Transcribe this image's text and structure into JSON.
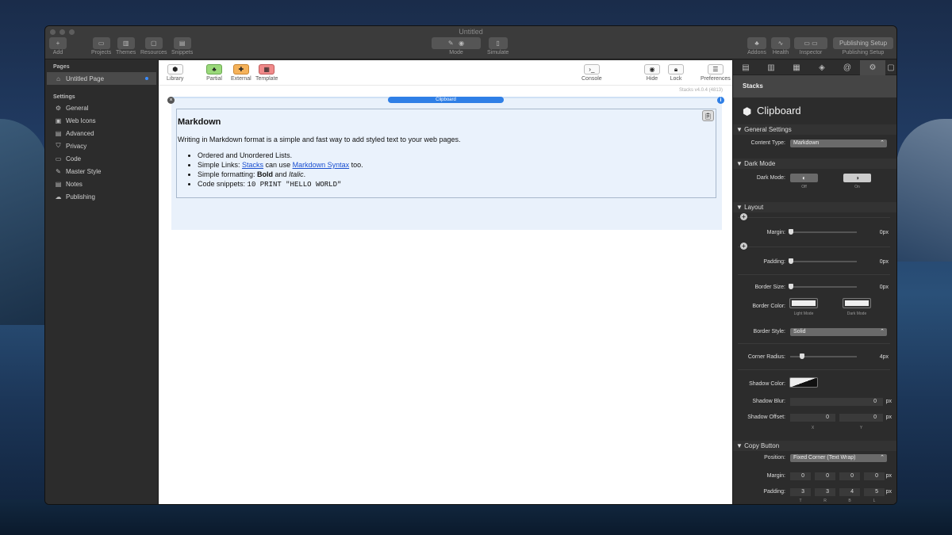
{
  "window": {
    "title": "Untitled"
  },
  "toolbar": {
    "add": "Add",
    "projects": "Projects",
    "themes": "Themes",
    "resources": "Resources",
    "snippets": "Snippets",
    "mode": "Mode",
    "simulate": "Simulate",
    "addons": "Addons",
    "health": "Health",
    "inspector": "Inspector",
    "publishing_setup_button": "Publishing Setup",
    "publishing_setup_label": "Publishing Setup"
  },
  "sidebar": {
    "pages_header": "Pages",
    "page": "Untitled Page",
    "settings_header": "Settings",
    "items": [
      "General",
      "Web Icons",
      "Advanced",
      "Privacy",
      "Code",
      "Master Style",
      "Notes",
      "Publishing"
    ]
  },
  "content_toolbar": {
    "library": "Library",
    "partial": "Partial",
    "external": "External",
    "template": "Template",
    "console": "Console",
    "hide": "Hide",
    "lock": "Lock",
    "preferences": "Preferences"
  },
  "stacks_version": "Stacks v4.0.4 (4813)",
  "stack": {
    "pill": "Clipboard",
    "heading": "Markdown",
    "intro": "Writing in Markdown format is a simple and fast way to add styled text to your web pages.",
    "li1": "Ordered and Unordered Lists.",
    "li2_pre": "Simple Links: ",
    "li2_link1": "Stacks",
    "li2_mid": " can use ",
    "li2_link2": "Markdown Syntax",
    "li2_post": " too.",
    "li3_pre": "Simple formatting: ",
    "li3_bold": "Bold",
    "li3_mid": " and ",
    "li3_italic": "Italic",
    "li3_post": ".",
    "li4_pre": "Code snippets: ",
    "li4_code": "10 PRINT \"HELLO WORLD\""
  },
  "inspector": {
    "header": "Stacks",
    "title": "Clipboard",
    "general_settings": "General Settings",
    "content_type_label": "Content Type:",
    "content_type": "Markdown",
    "dark_mode_section": "Dark Mode",
    "dark_mode_label": "Dark Mode:",
    "off": "Off",
    "on": "On",
    "layout_section": "Layout",
    "margin_label": "Margin:",
    "margin_val": "0px",
    "padding_label": "Padding:",
    "padding_val": "0px",
    "border_size_label": "Border Size:",
    "border_size_val": "0px",
    "border_color_label": "Border Color:",
    "light_mode": "Light Mode",
    "dark_mode": "Dark Mode",
    "border_style_label": "Border Style:",
    "border_style": "Solid",
    "corner_radius_label": "Corner Radius:",
    "corner_radius_val": "4px",
    "shadow_color_label": "Shadow Color:",
    "shadow_blur_label": "Shadow Blur:",
    "shadow_blur": "0",
    "px": "px",
    "shadow_offset_label": "Shadow Offset:",
    "shadow_x": "0",
    "shadow_y": "0",
    "x": "X",
    "y": "Y",
    "copy_button_section": "Copy Button",
    "position_label": "Position:",
    "position": "Fixed Corner (Text Wrap)",
    "cb_margin_label": "Margin:",
    "cb_margin": [
      "0",
      "0",
      "0",
      "0"
    ],
    "cb_padding_label": "Padding:",
    "cb_padding": [
      "3",
      "3",
      "4",
      "5"
    ],
    "tbrl": [
      "T",
      "R",
      "B",
      "L"
    ]
  },
  "colors": {
    "accent": "#3a8cff",
    "pill": "#2f7fe6",
    "stack_bg": "#e9f1fb"
  }
}
